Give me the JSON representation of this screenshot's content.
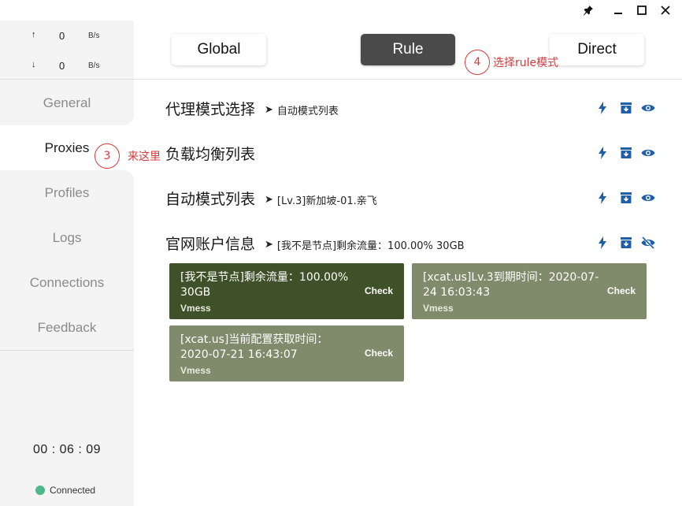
{
  "titlebar": {
    "icons": [
      "pin-icon",
      "minimize-icon",
      "maximize-icon",
      "close-icon"
    ]
  },
  "sidebar": {
    "upload": {
      "arrow": "↑",
      "value": "0",
      "unit": "B/s"
    },
    "download": {
      "arrow": "↓",
      "value": "0",
      "unit": "B/s"
    },
    "items": [
      {
        "label": "General"
      },
      {
        "label": "Proxies"
      },
      {
        "label": "Profiles"
      },
      {
        "label": "Logs"
      },
      {
        "label": "Connections"
      },
      {
        "label": "Feedback"
      }
    ],
    "active_item": "Proxies",
    "timer": "00 : 06 : 09",
    "status": {
      "label": "Connected",
      "color": "#4db88a"
    }
  },
  "modes": {
    "global": "Global",
    "rule": "Rule",
    "direct": "Direct",
    "active": "Rule"
  },
  "annotations": {
    "step3": {
      "num": "3",
      "text": "来这里"
    },
    "step4": {
      "num": "4",
      "text": "选择rule模式"
    },
    "color": "#d63b3b"
  },
  "groups": [
    {
      "title": "代理模式选择",
      "selected": "自动模式列表",
      "icons": [
        "bolt-icon",
        "archive-icon",
        "eye-icon"
      ]
    },
    {
      "title": "负载均衡列表",
      "selected": "",
      "icons": [
        "bolt-icon",
        "archive-icon",
        "eye-icon"
      ]
    },
    {
      "title": "自动模式列表",
      "selected": "[Lv.3]新加坡-01.亲飞",
      "icons": [
        "bolt-icon",
        "archive-icon",
        "eye-icon"
      ]
    },
    {
      "title": "官网账户信息",
      "selected": "[我不是节点]剩余流量：100.00% 30GB",
      "icons": [
        "bolt-icon",
        "archive-icon",
        "eye-off-icon"
      ]
    }
  ],
  "proxies": [
    {
      "name": "[我不是节点]剩余流量：100.00% 30GB",
      "type": "Vmess",
      "check": "Check",
      "selected": true
    },
    {
      "name": "[xcat.us]Lv.3到期时间：2020-07-24 16:03:43",
      "type": "Vmess",
      "check": "Check",
      "selected": false
    },
    {
      "name": "[xcat.us]当前配置获取时间：2020-07-21 16:43:07",
      "type": "Vmess",
      "check": "Check",
      "selected": false
    }
  ],
  "colors": {
    "accent_icon": "#1f5fa8",
    "card_selected": "#3f5128",
    "card_normal": "#7f8b6b",
    "mode_active": "#4a4a4a"
  }
}
